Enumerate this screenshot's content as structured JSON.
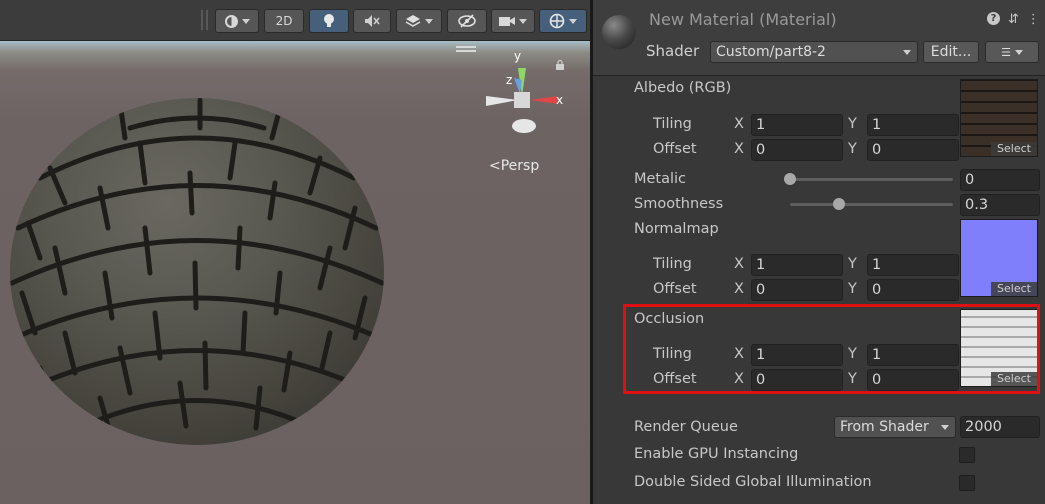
{
  "scene": {
    "toolbar": {
      "two_d_label": "2D"
    },
    "view_mode_label": "Persp",
    "gizmo": {
      "y_label": "y",
      "x_label": "x",
      "z_label": "z"
    }
  },
  "inspector": {
    "material_title": "New Material (Material)",
    "shader_label": "Shader",
    "shader_value": "Custom/part8-2",
    "edit_button": "Edit...",
    "properties": {
      "albedo": {
        "label": "Albedo (RGB)",
        "tiling_label": "Tiling",
        "offset_label": "Offset",
        "tiling_x": "1",
        "tiling_y": "1",
        "offset_x": "0",
        "offset_y": "0",
        "select_label": "Select"
      },
      "metallic": {
        "label": "Metalic",
        "value": "0",
        "fraction": 0
      },
      "smoothness": {
        "label": "Smoothness",
        "value": "0.3",
        "fraction": 0.3
      },
      "normalmap": {
        "label": "Normalmap",
        "tiling_label": "Tiling",
        "offset_label": "Offset",
        "tiling_x": "1",
        "tiling_y": "1",
        "offset_x": "0",
        "offset_y": "0",
        "select_label": "Select"
      },
      "occlusion": {
        "label": "Occlusion",
        "tiling_label": "Tiling",
        "offset_label": "Offset",
        "tiling_x": "1",
        "tiling_y": "1",
        "offset_x": "0",
        "offset_y": "0",
        "select_label": "Select"
      }
    },
    "axis_x": "X",
    "axis_y": "Y",
    "render_queue": {
      "label": "Render Queue",
      "dropdown": "From Shader",
      "value": "2000"
    },
    "gpu_instancing": {
      "label": "Enable GPU Instancing",
      "checked": false
    },
    "double_sided_gi": {
      "label": "Double Sided Global Illumination",
      "checked": false
    },
    "colors": {
      "highlight": "#e01010",
      "accent_button": "#46607c"
    }
  }
}
